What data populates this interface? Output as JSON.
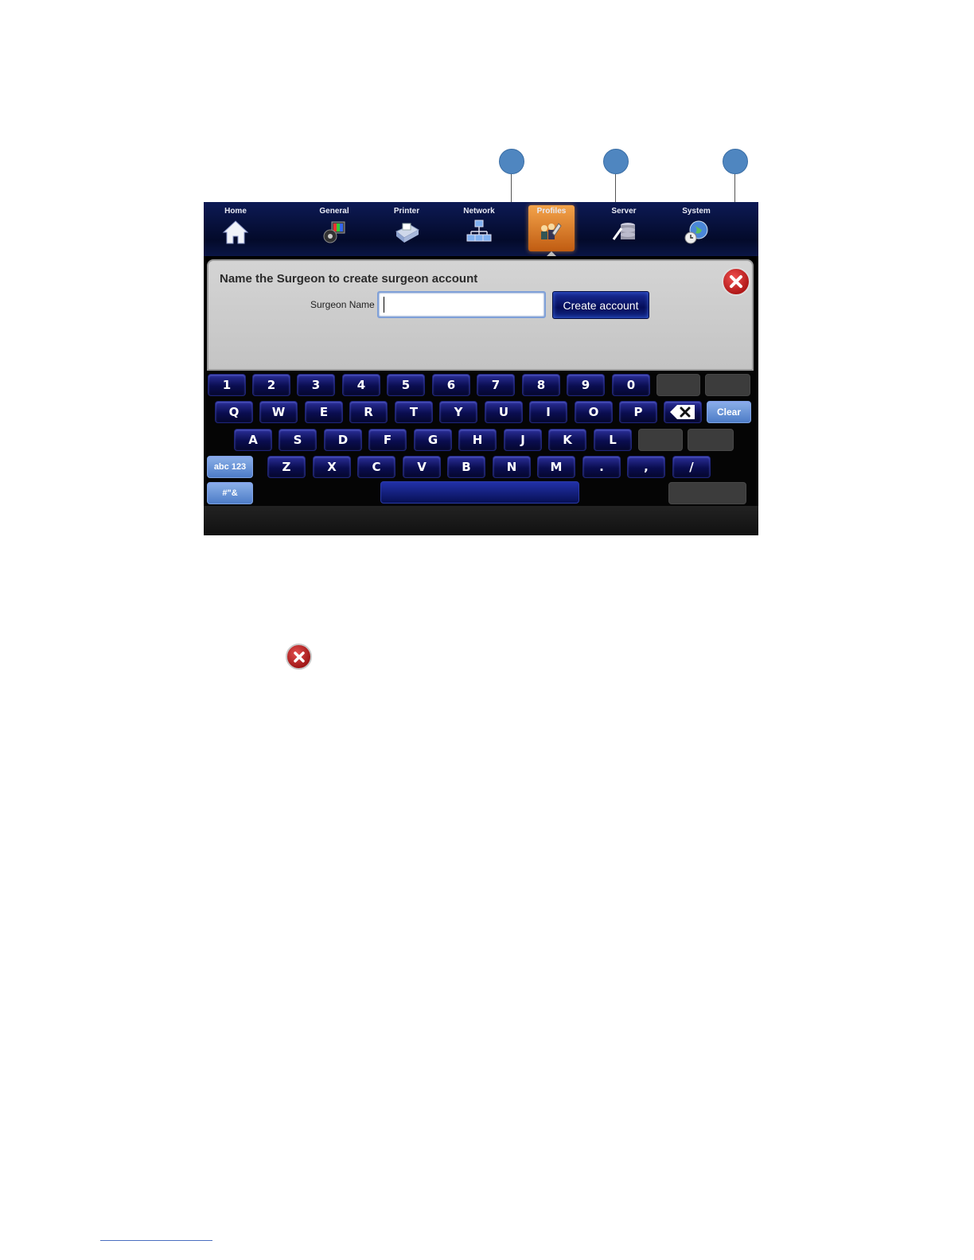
{
  "nav": {
    "items": [
      {
        "label": "Home",
        "icon": "home-icon"
      },
      {
        "label": "General",
        "icon": "general-icon"
      },
      {
        "label": "Printer",
        "icon": "printer-icon"
      },
      {
        "label": "Network",
        "icon": "network-icon"
      },
      {
        "label": "Profiles",
        "icon": "profiles-icon",
        "active": true
      },
      {
        "label": "Server",
        "icon": "server-icon"
      },
      {
        "label": "System",
        "icon": "system-icon"
      }
    ],
    "active_color": "#e07a22"
  },
  "dialog": {
    "title": "Name the Surgeon to create surgeon account",
    "field_label": "Surgeon Name",
    "field_value": "",
    "create_button": "Create account",
    "close_icon": "close-icon"
  },
  "keyboard": {
    "row1": [
      "1",
      "2",
      "3",
      "4",
      "5",
      "6",
      "7",
      "8",
      "9",
      "0"
    ],
    "row2": [
      "Q",
      "W",
      "E",
      "R",
      "T",
      "Y",
      "U",
      "I",
      "O",
      "P"
    ],
    "row3": [
      "A",
      "S",
      "D",
      "F",
      "G",
      "H",
      "J",
      "K",
      "L"
    ],
    "row4": [
      "Z",
      "X",
      "C",
      "V",
      "B",
      "N",
      "M",
      ".",
      ",",
      "/"
    ],
    "clear_label": "Clear",
    "mode_abc_label": "abc 123",
    "mode_symbols_label": "#\"&",
    "backspace_icon": "backspace-icon"
  },
  "callouts": [
    {
      "icon": "callout-marker"
    },
    {
      "icon": "callout-marker"
    },
    {
      "icon": "callout-marker"
    }
  ],
  "colors": {
    "keyboard_key": "#0a0d50",
    "close_red": "#c02020",
    "callout_blue": "#4f86c0"
  }
}
